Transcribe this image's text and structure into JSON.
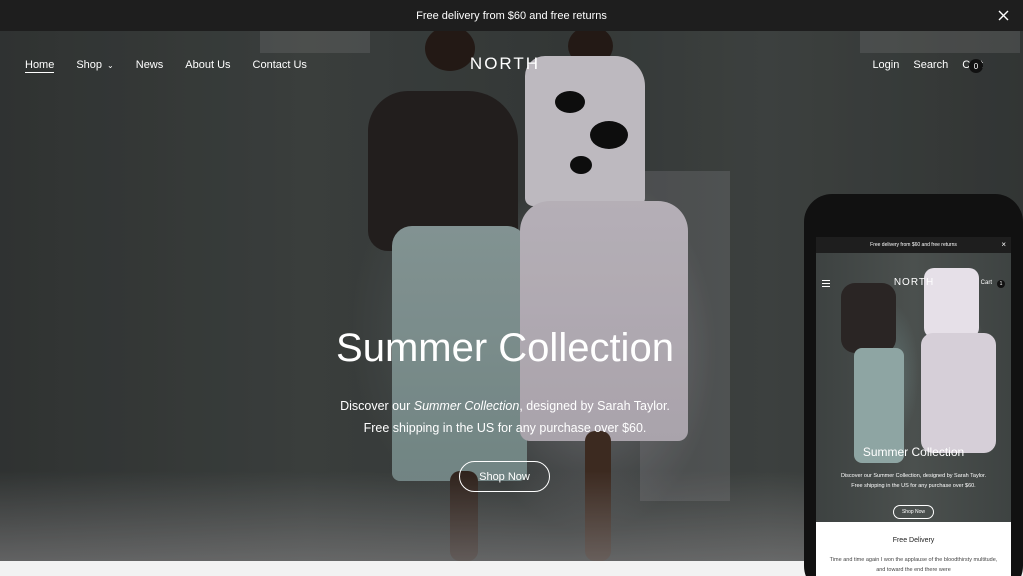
{
  "announcement": {
    "text": "Free delivery from $60 and free returns"
  },
  "nav": {
    "items": [
      "Home",
      "Shop",
      "News",
      "About Us",
      "Contact Us"
    ],
    "logo": "NORTH",
    "right": {
      "login": "Login",
      "search": "Search",
      "cart": "Cart",
      "cart_count": "0"
    }
  },
  "hero": {
    "title": "Summer Collection",
    "sub_line1_a": "Discover our ",
    "sub_line1_em": "Summer Collection",
    "sub_line1_b": ", designed by Sarah Taylor.",
    "sub_line2": "Free shipping in the US for any purchase over $60.",
    "button": "Shop Now"
  },
  "mobile": {
    "announcement": "Free delivery from $60 and free returns",
    "logo": "NORTH",
    "cart": "Cart",
    "cart_count": "1",
    "title": "Summer Collection",
    "sub_line1": "Discover our Summer Collection, designed by Sarah Taylor.",
    "sub_line2": "Free shipping in the US for any purchase over $60.",
    "button": "Shop Now",
    "feature_title": "Free Delivery",
    "feature_text": "Time and time again I won the applause of the bloodthirsty multitude, and toward the end there were"
  },
  "icons": {
    "close": "close-icon",
    "caret": "chevron-down-icon",
    "menu": "menu-icon"
  },
  "colors": {
    "announcement_bg": "#1e1e1e",
    "text_light": "#ffffff",
    "phone_frame": "#111111"
  }
}
